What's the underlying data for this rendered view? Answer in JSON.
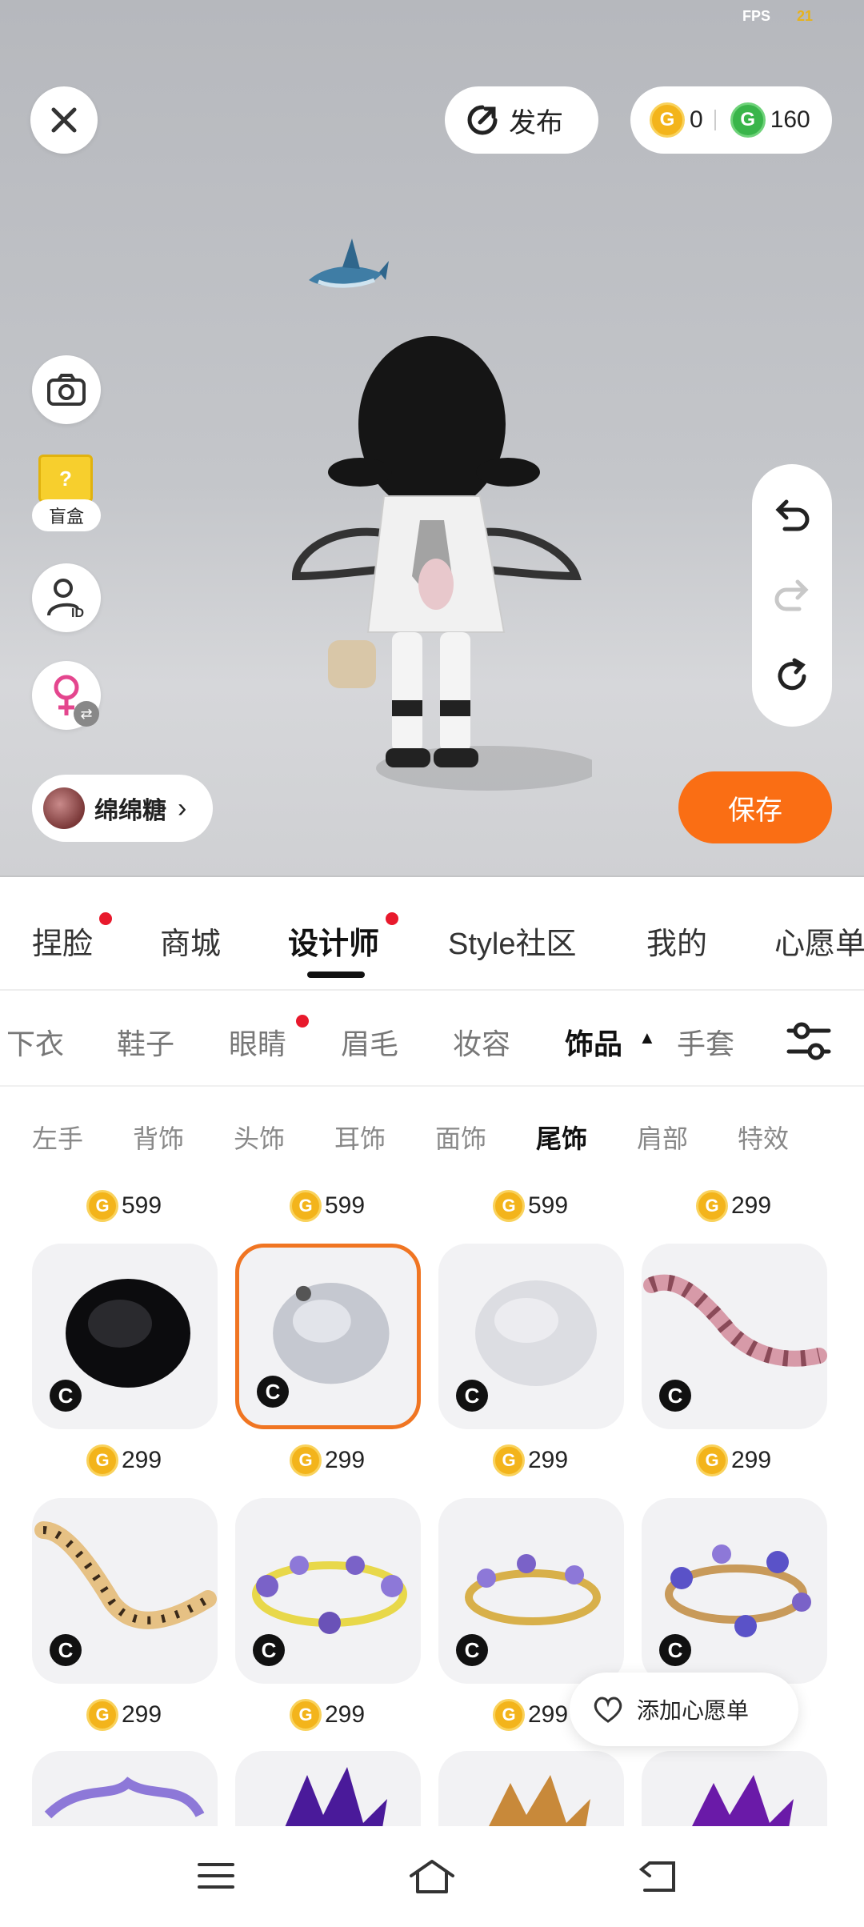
{
  "status": {
    "fps_label": "FPS",
    "fps_value": "21"
  },
  "top_bar": {
    "publish_label": "发布",
    "currency": {
      "gold_value": "0",
      "green_value": "160",
      "gold_symbol": "G",
      "green_symbol": "G"
    }
  },
  "side_tools": {
    "blindbox_label": "盲盒",
    "blindbox_box_symbol": "?",
    "gender_swap_symbol": "⇄"
  },
  "user": {
    "name": "绵绵糖",
    "chevron": "›"
  },
  "save_label": "保存",
  "main_tabs": [
    {
      "label": "捏脸",
      "dot": true
    },
    {
      "label": "商城",
      "dot": false
    },
    {
      "label": "设计师",
      "dot": true,
      "active": true
    },
    {
      "label": "Style社区",
      "dot": false
    },
    {
      "label": "我的",
      "dot": false
    },
    {
      "label": "心愿单",
      "dot": false
    }
  ],
  "category_tabs": [
    {
      "label": "下衣"
    },
    {
      "label": "鞋子"
    },
    {
      "label": "眼睛",
      "dot": true
    },
    {
      "label": "眉毛"
    },
    {
      "label": "妆容"
    },
    {
      "label": "饰品",
      "active": true,
      "arrow": "▲"
    },
    {
      "label": "手套"
    }
  ],
  "sub_tabs": [
    {
      "label": "左手"
    },
    {
      "label": "背饰"
    },
    {
      "label": "头饰"
    },
    {
      "label": "耳饰"
    },
    {
      "label": "面饰"
    },
    {
      "label": "尾饰",
      "active": true
    },
    {
      "label": "肩部"
    },
    {
      "label": "特效"
    }
  ],
  "grid": {
    "badge_symbol": "C",
    "price_symbol": "G",
    "top_prices": [
      "599",
      "599",
      "599",
      "299"
    ],
    "rows": [
      {
        "items": [
          {
            "name": "black-fluffy-tail",
            "price": "299"
          },
          {
            "name": "gray-fluffy-tail",
            "price": "299",
            "selected": true
          },
          {
            "name": "white-fluffy-tail",
            "price": "299"
          },
          {
            "name": "pink-striped-tail",
            "price": "299"
          }
        ]
      },
      {
        "items": [
          {
            "name": "leopard-tail",
            "price": "299"
          },
          {
            "name": "purple-flower-halo-1",
            "price": "299"
          },
          {
            "name": "purple-flower-halo-2",
            "price": "299"
          },
          {
            "name": "purple-flower-halo-3",
            "price": "299"
          }
        ]
      }
    ]
  },
  "wishlist_popover": {
    "label": "添加心愿单"
  },
  "colors": {
    "accent": "#fa6e14",
    "selected_border": "#f07522",
    "red_dot": "#e8192c",
    "gold_coin": "#f3b41b",
    "green_coin": "#39b54a"
  }
}
